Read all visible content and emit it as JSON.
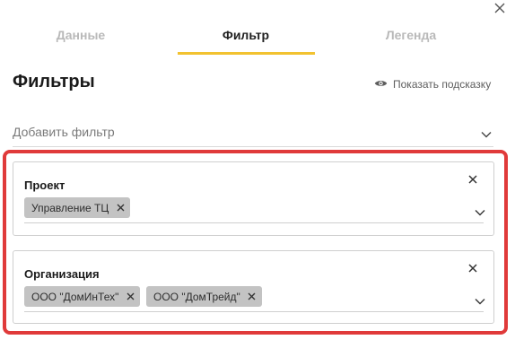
{
  "tabs": [
    {
      "label": "Данные",
      "active": false
    },
    {
      "label": "Фильтр",
      "active": true
    },
    {
      "label": "Легенда",
      "active": false
    }
  ],
  "title": "Фильтры",
  "hint": {
    "icon": "eye-icon",
    "label": "Показать подсказку"
  },
  "add_filter": {
    "placeholder": "Добавить фильтр",
    "icon": "chevron-down-icon"
  },
  "filters": [
    {
      "label": "Проект",
      "chips": [
        "Управление ТЦ"
      ]
    },
    {
      "label": "Организация",
      "chips": [
        "ООО \"ДомИнТех\"",
        "ООО \"ДомТрейд\""
      ]
    }
  ],
  "colors": {
    "accent": "#f2c230",
    "highlight": "#e03a3a",
    "chip": "#c3c3c3"
  }
}
